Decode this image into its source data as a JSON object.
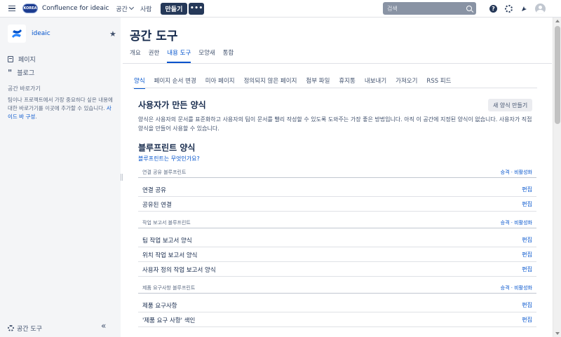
{
  "topnav": {
    "logo_text": "KOREA",
    "app_name": "Confluence for ideaic",
    "spaces_label": "공간",
    "people_label": "사람",
    "create_label": "만들기",
    "more_label": "•••",
    "search_placeholder": "검색",
    "help_label": "?"
  },
  "sidebar": {
    "space_name": "ideaic",
    "pages_label": "페이지",
    "blog_label": "블로그",
    "shortcuts_title": "공간 바로가기",
    "shortcuts_desc": "팀이나 프로젝트에서 가장 중요하다 싶은 내용에 대한 바로가기를 이곳에 추가할 수 있습니다.",
    "shortcuts_link": "사이드 바 구성",
    "shortcuts_link_suffix": ".",
    "space_tools_label": "공간 도구",
    "collapse_label": "«"
  },
  "main": {
    "title": "공간 도구",
    "tabs": [
      {
        "label": "개요"
      },
      {
        "label": "권한"
      },
      {
        "label": "내용 도구"
      },
      {
        "label": "모양새"
      },
      {
        "label": "통합"
      }
    ],
    "active_tab": "내용 도구",
    "subtabs": [
      {
        "label": "양식"
      },
      {
        "label": "페이지 순서 변경"
      },
      {
        "label": "미아 페이지"
      },
      {
        "label": "정의되지 않은 페이지"
      },
      {
        "label": "첨부 파일"
      },
      {
        "label": "휴지통"
      },
      {
        "label": "내보내기"
      },
      {
        "label": "가져오기"
      },
      {
        "label": "RSS 피드"
      }
    ],
    "active_subtab": "양식",
    "user_templates_title": "사용자가 만든 양식",
    "new_template_button": "새 양식 만들기",
    "user_templates_desc": "양식은 사용자의 문서를 표준화하고 사용자의 팀이 문서를 빨리 작성할 수 있도록 도와주는 가장 좋은 방법입니다. 아직 이 공간에 지정된 양식이 없습니다. 사용자가 직접 양식을 만들어 사용할 수 있습니다.",
    "blueprint_title": "블루프린트 양식",
    "blueprint_link": "블루프린트는 무엇인가요?",
    "groups": [
      {
        "name": "연결 공유 블루프린트",
        "action": "승격 · 비활성화",
        "rows": [
          {
            "name": "연결 공유",
            "edit": "편집"
          },
          {
            "name": "공유된 연결",
            "edit": "편집"
          }
        ]
      },
      {
        "name": "작업 보고서 블루프린트",
        "action": "승격 · 비활성화",
        "rows": [
          {
            "name": "팀 작업 보고서 양식",
            "edit": "편집"
          },
          {
            "name": "위치 작업 보고서 양식",
            "edit": "편집"
          },
          {
            "name": "사용자 정의 작업 보고서 양식",
            "edit": "편집"
          }
        ]
      },
      {
        "name": "제품 요구사항 블루프린트",
        "action": "승격 · 비활성화",
        "rows": [
          {
            "name": "제품 요구사항",
            "edit": "편집"
          },
          {
            "name": "'제품 요구 사항' 색인",
            "edit": "편집"
          }
        ]
      }
    ]
  },
  "colors": {
    "accent": "#0052cc",
    "nav_dark": "#253858",
    "sidebar_bg": "#f4f5f7",
    "text": "#172b4d"
  }
}
